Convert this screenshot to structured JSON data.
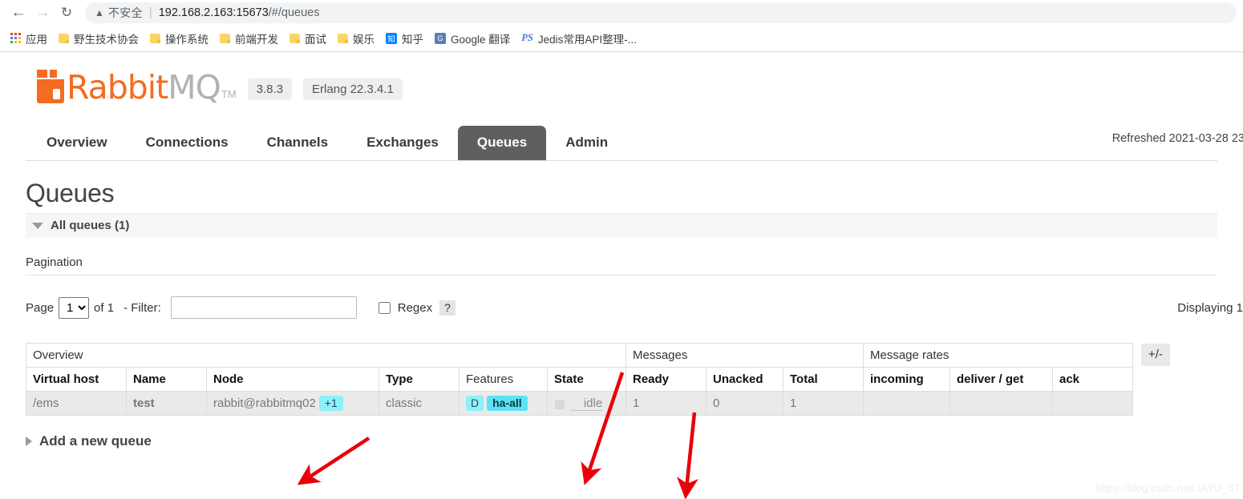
{
  "browser": {
    "back_icon": "back-arrow-icon",
    "forward_icon": "forward-arrow-icon",
    "reload_icon": "reload-icon",
    "warning_icon": "warning-triangle-icon",
    "security_text": "不安全",
    "separator": "|",
    "url_host": "192.168.2.163:15673",
    "url_path": "/#/queues",
    "bookmarks": [
      {
        "label": "应用",
        "icon": "apps-grid-icon"
      },
      {
        "label": "野生技术协会",
        "icon": "folder-icon"
      },
      {
        "label": "操作系统",
        "icon": "folder-icon"
      },
      {
        "label": "前端开发",
        "icon": "folder-icon"
      },
      {
        "label": "面试",
        "icon": "folder-icon"
      },
      {
        "label": "娱乐",
        "icon": "folder-icon"
      },
      {
        "label": "知乎",
        "icon": "zhihu-icon",
        "icon_text": "知"
      },
      {
        "label": "Google 翻译",
        "icon": "google-translate-icon",
        "icon_text": "G"
      },
      {
        "label": "Jedis常用API整理-...",
        "icon": "ps-icon",
        "icon_text": "PS"
      }
    ]
  },
  "header": {
    "logo_rabbit": "Rabbit",
    "logo_mq": "MQ",
    "logo_tm": "TM",
    "version": "3.8.3",
    "erlang_version": "Erlang 22.3.4.1",
    "refreshed": "Refreshed 2021-03-28 23:"
  },
  "nav": {
    "tabs": [
      {
        "label": "Overview",
        "active": false
      },
      {
        "label": "Connections",
        "active": false
      },
      {
        "label": "Channels",
        "active": false
      },
      {
        "label": "Exchanges",
        "active": false
      },
      {
        "label": "Queues",
        "active": true
      },
      {
        "label": "Admin",
        "active": false
      }
    ]
  },
  "main": {
    "page_title": "Queues",
    "all_queues_label": "All queues (1)",
    "pagination_label": "Pagination",
    "page_label": "Page",
    "page_value": "1",
    "page_options": [
      "1"
    ],
    "of_label": "of 1",
    "filter_label": "- Filter:",
    "filter_value": "",
    "regex_label": "Regex",
    "help_label": "?",
    "displaying": "Displaying 1",
    "plus_minus": "+/-",
    "add_queue_label": "Add a new queue"
  },
  "table": {
    "group_headers": [
      {
        "label": "Overview",
        "span": 6
      },
      {
        "label": "Messages",
        "span": 3
      },
      {
        "label": "Message rates",
        "span": 3
      }
    ],
    "columns": [
      "Virtual host",
      "Name",
      "Node",
      "Type",
      "Features",
      "State",
      "Ready",
      "Unacked",
      "Total",
      "incoming",
      "deliver / get",
      "ack"
    ],
    "rows": [
      {
        "vhost": "/ems",
        "name": "test",
        "node": "rabbit@rabbitmq02",
        "node_badge": "+1",
        "type": "classic",
        "feature_d": "D",
        "feature_ha": "ha-all",
        "state": "idle",
        "ready": "1",
        "unacked": "0",
        "total": "1",
        "incoming": "",
        "deliver_get": "",
        "ack": ""
      }
    ]
  },
  "annotations": {
    "arrow_color": "#e8000a",
    "arrows": [
      {
        "name": "arrow-to-node-column"
      },
      {
        "name": "arrow-to-state-column"
      },
      {
        "name": "arrow-to-ready-column"
      }
    ]
  },
  "watermark": "https://blog.csdn.net/JAYU_37"
}
